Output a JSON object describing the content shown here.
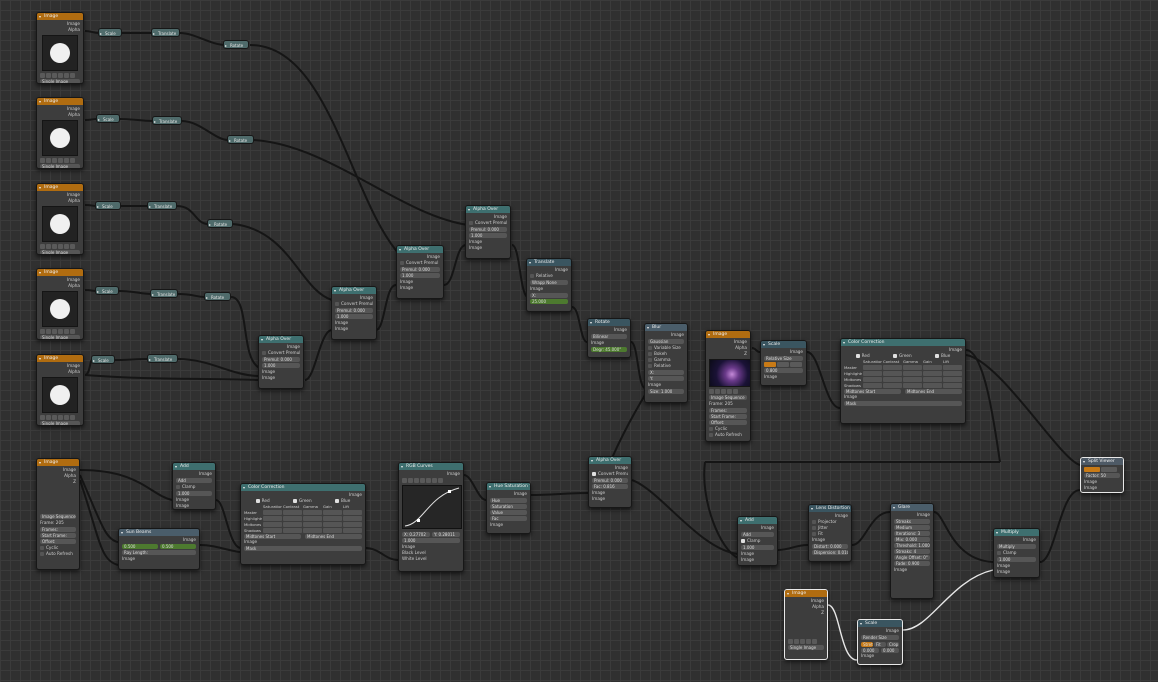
{
  "colors": {
    "bg": "#303030",
    "input_header": "#b06c10",
    "wire": "#1a1a1a",
    "wire_selected": "#e8e8e8",
    "socket_color": "#c8c83c"
  },
  "icons": [
    "collapse-arrow-icon",
    "image-thumbnail-icon",
    "socket-icon"
  ],
  "nodes": {
    "image": {
      "title": "Image",
      "out_image": "Image",
      "out_alpha": "Alpha",
      "out_z": "Z",
      "single": "Single Image",
      "seq": "Image Sequence",
      "frames_label": "Frames:",
      "frames": "Frame: 205",
      "start": "Start Frame:",
      "offset": "Offset:",
      "cyclic": "Cyclic",
      "auto": "Auto Refresh"
    },
    "scale": {
      "title": "Scale",
      "relative": "Relative Size",
      "x": "X",
      "y": "Y",
      "rel": "Rel",
      "abs": "Abs",
      "fit": "Fit",
      "val1": "0.800",
      "val2": "0.800"
    },
    "translate": {
      "title": "Translate"
    },
    "rotate": {
      "title": "Rotate",
      "filter": "Bilinear",
      "degree": "Degr: 35.000°"
    },
    "alpha_over": {
      "title": "Alpha Over",
      "convert": "Convert Premul",
      "premul": "Premul: 0.000",
      "fac": "Fac",
      "fac_val": "1.000",
      "image": "Image"
    },
    "translate2": {
      "title": "Translate",
      "relative": "Relative",
      "wrap": "Wrapp None",
      "x": "X:",
      "y": "Y:",
      "yval": "25.000"
    },
    "rotate2": {
      "title": "Rotate",
      "mode": "Bilinear",
      "deg": "Degr: 45.000°"
    },
    "blur": {
      "title": "Blur",
      "type": "Gaussian",
      "opts": [
        "Variable Size",
        "Bokeh",
        "Gamma",
        "Relative"
      ],
      "x": "X:",
      "y": "Y:",
      "size": "Size: 1.000"
    },
    "img_seq": {
      "title": "Image",
      "seq": "Image Sequence",
      "frame": "Frame: 205",
      "frames": "Frames:",
      "start": "Start Frame:",
      "offset": "Offset:",
      "cyclic": "Cyclic",
      "auto": "Auto Refresh"
    },
    "color_correction": {
      "title": "Color Correction",
      "r": "Red",
      "g": "Green",
      "b": "Blue",
      "cols": [
        "Saturation",
        "Contrast",
        "Gamma",
        "Gain",
        "Lift"
      ],
      "rows": [
        "Master",
        "Highlights",
        "Midtones",
        "Shadows"
      ],
      "mid_start": "Midtones Start",
      "mid_end": "Midtones End",
      "mid_start_val": "0.200",
      "mid_end_val": "0.700",
      "mask": "Mask",
      "mask_val": "1.000",
      "image": "Image"
    },
    "split_viewer": {
      "title": "Split Viewer",
      "x": "X",
      "y": "Y",
      "factor": "Factor: 50"
    },
    "add": {
      "title": "Add",
      "mode": "Add",
      "clamp": "Clamp",
      "fac": "Fac",
      "fac_val": "1.000",
      "image": "Image"
    },
    "sun_beams": {
      "title": "Sun Beams",
      "ray": "Ray Length:",
      "ray_val": "0.200",
      "source": "0.500",
      "source2": "0.500"
    },
    "rgb_curves": {
      "title": "RGB Curves",
      "c": "C",
      "r": "R",
      "g": "G",
      "b": "B",
      "x": "X: 0.27702",
      "y": "Y: 0.28011",
      "fac": "Fac",
      "fac_val": "1.000",
      "black": "Black Level",
      "white": "White Level"
    },
    "hsv": {
      "title": "Hue Saturation Value",
      "hue": "Hue",
      "hue_val": "0.500",
      "sat": "Saturation",
      "sat_val": "1.000",
      "val": "Value",
      "val_val": "1.000",
      "fac": "Fac",
      "fac_val": "1.000"
    },
    "alpha_over2": {
      "title": "Alpha Over",
      "convert": "Convert Premul",
      "premul": "Premul: 0.000",
      "fac": "Fac: 0.816"
    },
    "lens": {
      "title": "Lens Distortion",
      "proj": "Projector",
      "jitter": "Jitter",
      "fit": "Fit",
      "distort": "Distort: 0.000",
      "disp": "Dispersion: 0.010"
    },
    "glare": {
      "title": "Glare",
      "type": "Streaks",
      "quality": "Medium",
      "iter": "Iterations: 3",
      "mix": "Mix: 0.000",
      "thresh": "Threshold: 1.000",
      "streaks": "Streaks: 4",
      "angle": "Angle Offset: 0°",
      "fade": "Fade: 0.900"
    },
    "multiply": {
      "title": "Multiply",
      "mode": "Multiply",
      "clamp": "Clamp",
      "fac": "Fac",
      "fac_val": "1.000"
    },
    "scale_bottom": {
      "title": "Scale",
      "relative": "Render Size",
      "stretch": "Stretch",
      "fit": "Fit",
      "crop": "Crop",
      "v1": "0.000",
      "v2": "0.000"
    }
  }
}
